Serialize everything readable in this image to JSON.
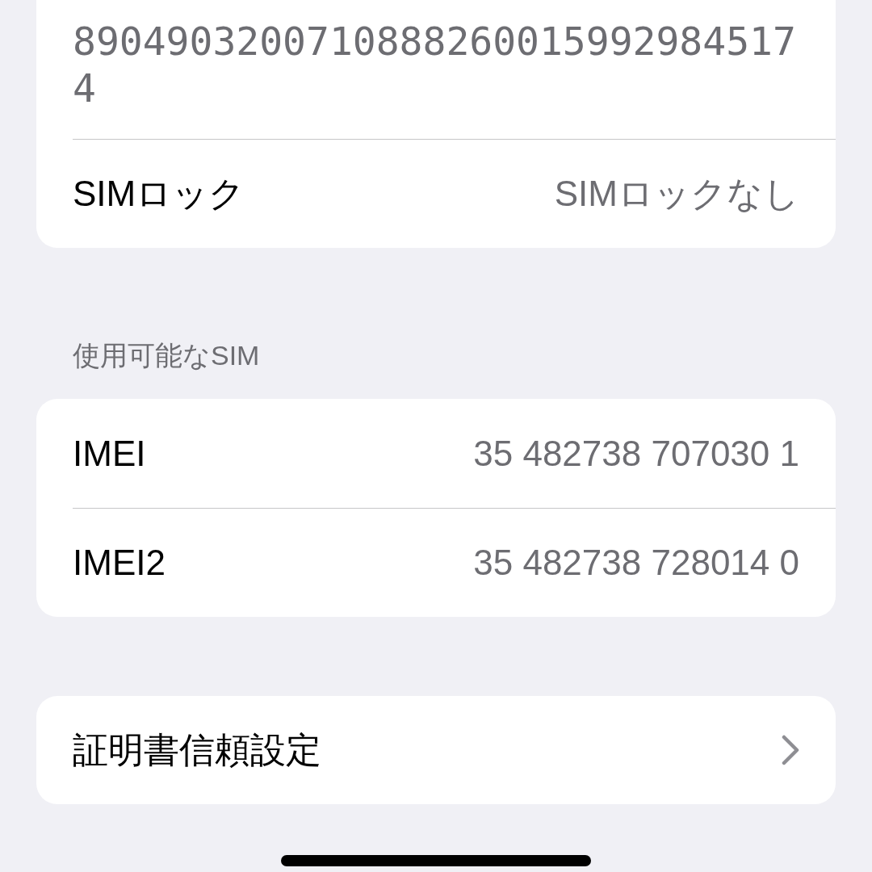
{
  "top_group": {
    "number": "89049032007108882600159929845174",
    "rows": [
      {
        "label": "SIMロック",
        "value": "SIMロックなし"
      }
    ]
  },
  "available_sim": {
    "header": "使用可能なSIM",
    "rows": [
      {
        "label": "IMEI",
        "value": "35 482738 707030 1"
      },
      {
        "label": "IMEI2",
        "value": "35 482738 728014 0"
      }
    ]
  },
  "links": [
    {
      "label": "証明書信頼設定",
      "kind": "link"
    }
  ]
}
